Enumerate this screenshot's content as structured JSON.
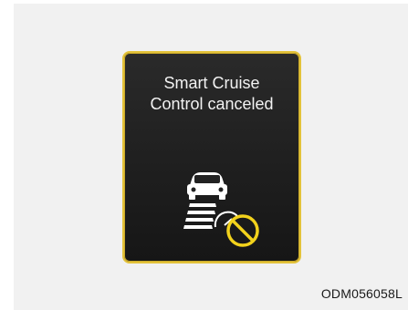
{
  "display": {
    "message_line1": "Smart Cruise",
    "message_line2": "Control canceled",
    "icon": "smart-cruise-control-cancel-icon",
    "colors": {
      "frame": "#e3c23a",
      "screen": "#222222",
      "text": "#f2f2f2",
      "icon": "#ffffff",
      "cancel_symbol": "#f2d21c"
    }
  },
  "caption": {
    "code": "ODM056058L"
  }
}
